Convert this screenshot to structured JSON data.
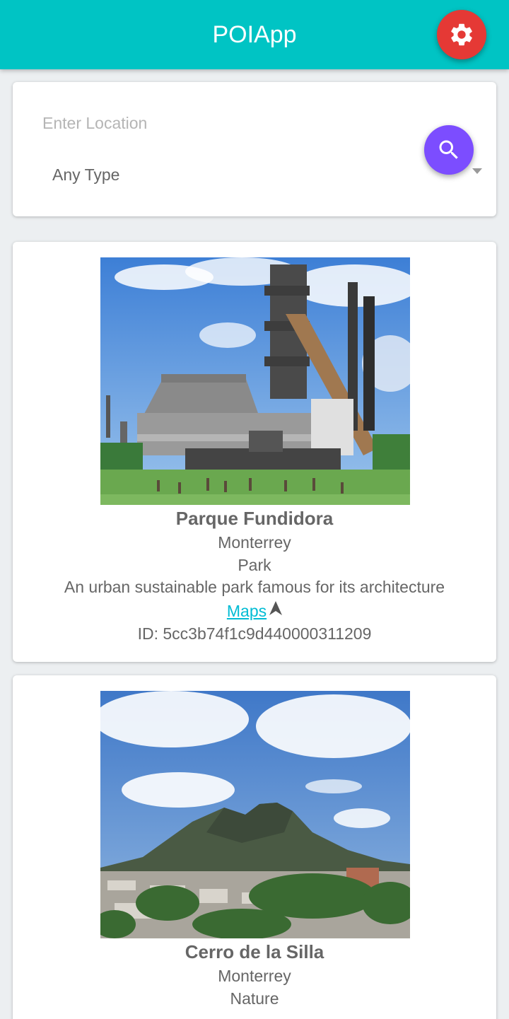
{
  "header": {
    "title": "POIApp",
    "settings_icon": "gear-icon",
    "bar_color": "#00c4c4",
    "settings_color": "#e53935"
  },
  "search": {
    "location_placeholder": "Enter Location",
    "location_value": "",
    "type_selected": "Any Type",
    "search_icon": "search-icon",
    "search_color": "#7c4dff"
  },
  "pois": [
    {
      "name": "Parque Fundidora",
      "city": "Monterrey",
      "type": "Park",
      "description": "An urban sustainable park famous for its architecture",
      "maps_label": "Maps",
      "id_text": "ID: 5cc3b74f1c9d440000311209"
    },
    {
      "name": "Cerro de la Silla",
      "city": "Monterrey",
      "type": "Nature"
    }
  ]
}
